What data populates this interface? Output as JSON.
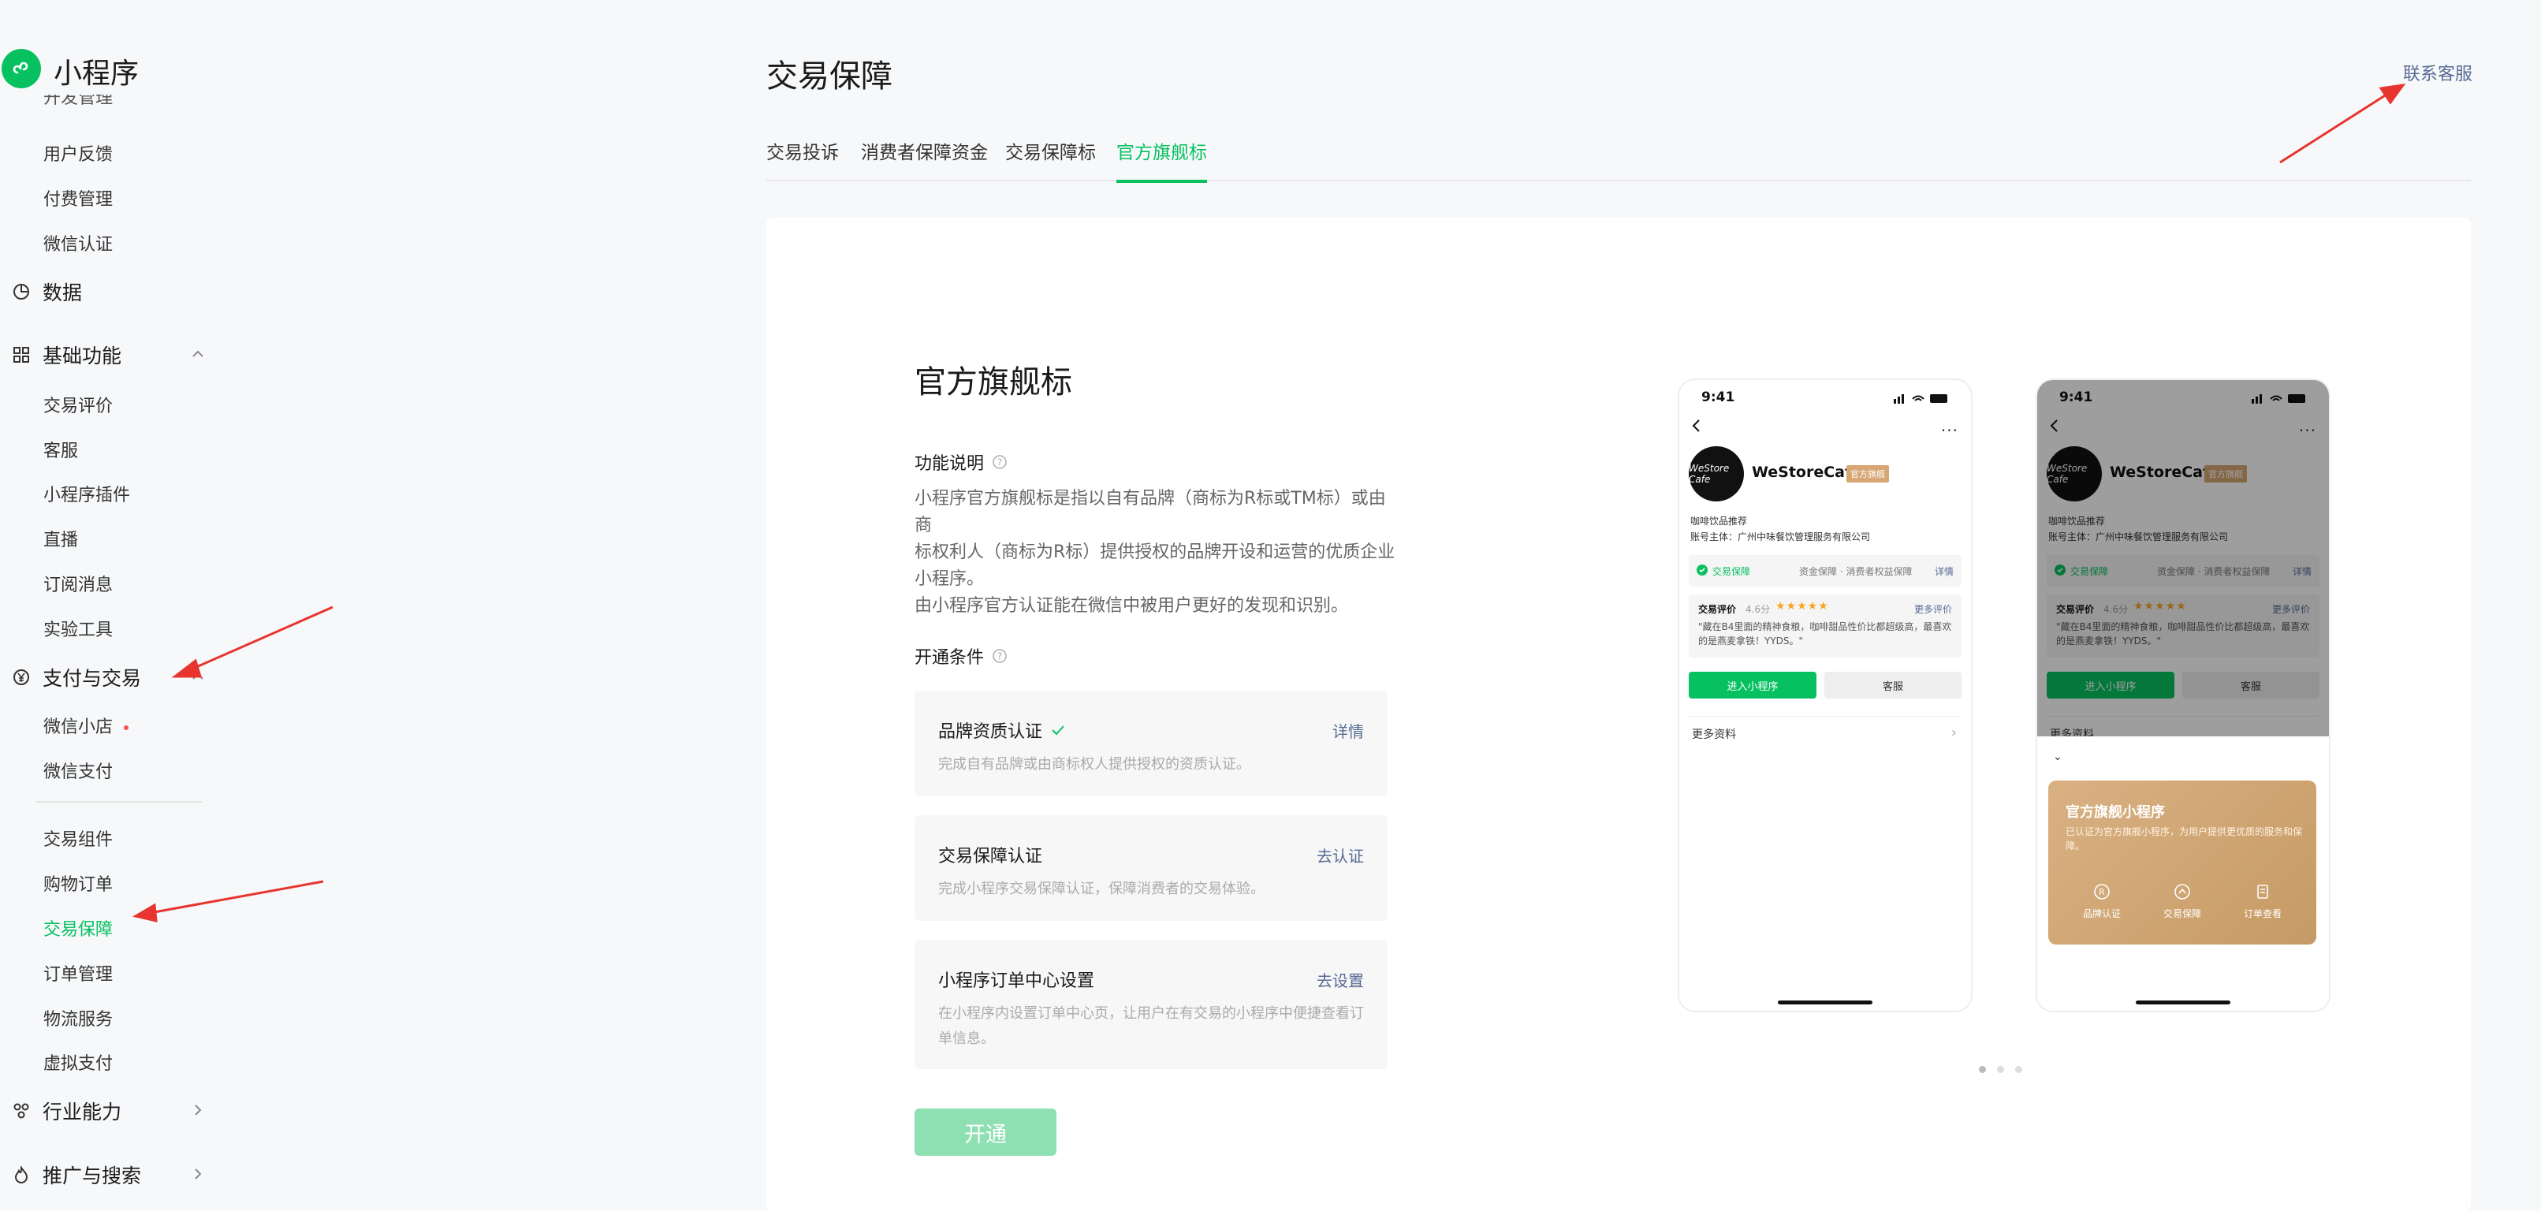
{
  "app": {
    "name": "小程序"
  },
  "sidebar": {
    "cut_item": "开发管理",
    "items_top": [
      {
        "label": "用户反馈"
      },
      {
        "label": "付费管理"
      },
      {
        "label": "微信认证"
      }
    ],
    "group_data": "数据",
    "group_basic": "基础功能",
    "basic_items": [
      {
        "label": "交易评价"
      },
      {
        "label": "客服"
      },
      {
        "label": "小程序插件"
      },
      {
        "label": "直播"
      },
      {
        "label": "订阅消息"
      },
      {
        "label": "实验工具"
      }
    ],
    "group_pay": "支付与交易",
    "pay_items": [
      {
        "label": "微信小店"
      },
      {
        "label": "微信支付"
      }
    ],
    "pay_items2": [
      {
        "label": "交易组件"
      },
      {
        "label": "购物订单"
      },
      {
        "label": "交易保障"
      },
      {
        "label": "订单管理"
      },
      {
        "label": "物流服务"
      },
      {
        "label": "虚拟支付"
      }
    ],
    "group_industry": "行业能力",
    "group_promo": "推广与搜索"
  },
  "header": {
    "title": "交易保障",
    "contact": "联系客服"
  },
  "tabs": [
    {
      "label": "交易投诉"
    },
    {
      "label": "消费者保障资金"
    },
    {
      "label": "交易保障标"
    },
    {
      "label": "官方旗舰标"
    }
  ],
  "feature": {
    "title": "官方旗舰标",
    "desc_label": "功能说明",
    "desc_lines": [
      "小程序官方旗舰标是指以自有品牌（商标为R标或TM标）或由商",
      "标权利人（商标为R标）提供授权的品牌开设和运营的优质企业",
      "小程序。",
      "由小程序官方认证能在微信中被用户更好的发现和识别。"
    ],
    "cond_label": "开通条件",
    "conditions": [
      {
        "title": "品牌资质认证",
        "action": "详情",
        "desc": "完成自有品牌或由商标权人提供授权的资质认证。"
      },
      {
        "title": "交易保障认证",
        "action": "去认证",
        "desc": "完成小程序交易保障认证，保障消费者的交易体验。"
      },
      {
        "title": "小程序订单中心设置",
        "action": "去设置",
        "desc": "在小程序内设置订单中心页，让用户在有交易的小程序中便捷查看订单信息。"
      }
    ],
    "open_button": "开通"
  },
  "phone": {
    "time": "9:41",
    "more": "···",
    "avatar_text": "WeStore Cafe",
    "name": "WeStoreCafe",
    "badge": "官方旗舰",
    "category": "咖啡饮品推荐",
    "subject": "账号主体：广州中味餐饮管理服务有限公司",
    "guarantee": "交易保障",
    "guarantee_right": "资金保障 · 消费者权益保障",
    "guarantee_detail": "详情",
    "review_label": "交易评价",
    "review_score": "4.6分",
    "review_stars": "★★★★★",
    "review_more": "更多评价",
    "review_quote": "\"藏在B4里面的精神食粮，咖啡甜品性价比都超级高，最喜欢的是燕麦拿铁！YYDS。\"",
    "enter": "进入小程序",
    "service": "客服",
    "more_info": "更多资料",
    "more_info_cut": "更多资料",
    "sheet_close": "⌄",
    "card_title": "官方旗舰小程序",
    "card_desc": "已认证为官方旗舰小程序，为用户提供更优质的服务和保障。",
    "features": [
      {
        "label": "品牌认证"
      },
      {
        "label": "交易保障"
      },
      {
        "label": "订单查看"
      }
    ]
  },
  "colors": {
    "accent": "#07c160",
    "link": "#576b95",
    "annotation": "#e8342e"
  }
}
